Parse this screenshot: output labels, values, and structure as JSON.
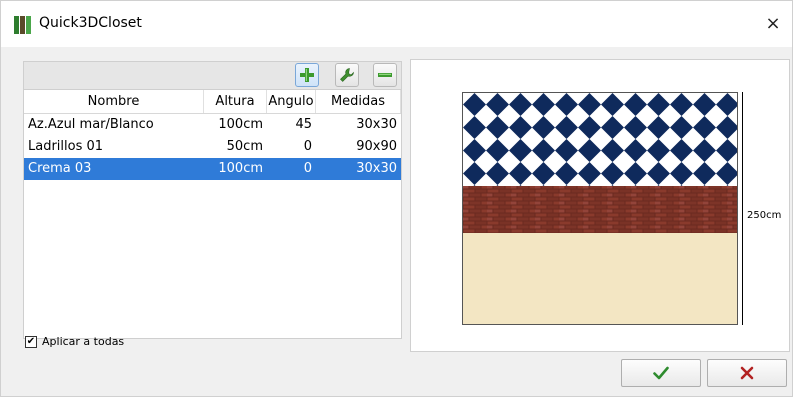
{
  "window": {
    "title": "Quick3DCloset",
    "close_glyph": "×",
    "icon_colors": [
      "#2e7d2e",
      "#5a4a2a",
      "#4aa64a"
    ]
  },
  "toolbar": {
    "add_icon": "plus-icon",
    "edit_icon": "wrench-icon",
    "remove_icon": "minus-icon"
  },
  "table": {
    "columns": [
      "Nombre",
      "Altura",
      "Angulo",
      "Medidas"
    ],
    "rows": [
      {
        "nombre": "Az.Azul mar/Blanco",
        "altura": "100cm",
        "angulo": "45",
        "medidas": "30x30"
      },
      {
        "nombre": "Ladrillos 01",
        "altura": "50cm",
        "angulo": "0",
        "medidas": "90x90"
      },
      {
        "nombre": "Crema 03",
        "altura": "100cm",
        "angulo": "0",
        "medidas": "30x30"
      }
    ],
    "selected_row": 2
  },
  "apply_all": {
    "label": "Aplicar a todas",
    "checked": true,
    "check_glyph": "✔"
  },
  "preview": {
    "height_label": "250cm",
    "tile_colors": {
      "navy": "#0f2a5c",
      "white": "#ffffff",
      "brick": "#7a3226",
      "cream": "#f3e6c3"
    }
  },
  "buttons": {
    "ok_icon": "check-icon",
    "cancel_icon": "x-icon",
    "ok_color": "#2e8b2e",
    "cancel_color": "#b22222"
  }
}
